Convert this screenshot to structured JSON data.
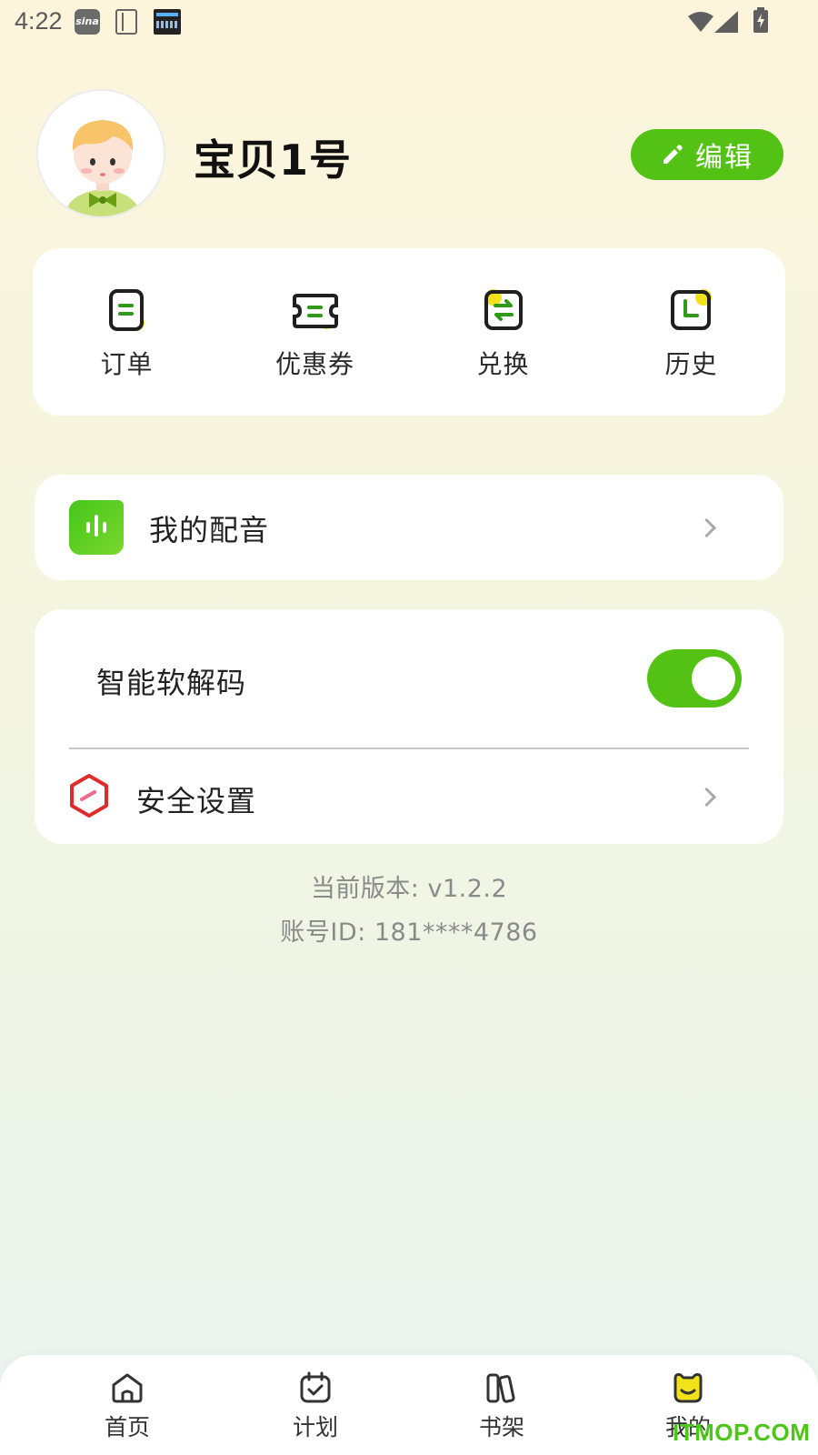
{
  "status_bar": {
    "time": "4:22",
    "icons": [
      "sina-weibo-icon",
      "notebook-icon",
      "clock-widget-icon",
      "wifi-icon",
      "signal-icon",
      "battery-charging-icon"
    ]
  },
  "profile": {
    "username": "宝贝1号",
    "edit_label": "编辑",
    "avatar_icon": "child-avatar"
  },
  "shortcuts": [
    {
      "label": "订单",
      "icon": "order-icon"
    },
    {
      "label": "优惠券",
      "icon": "coupon-icon"
    },
    {
      "label": "兑换",
      "icon": "exchange-icon"
    },
    {
      "label": "历史",
      "icon": "history-icon"
    }
  ],
  "dubbing": {
    "label": "我的配音",
    "icon": "audio-bars-icon"
  },
  "settings": {
    "decoder_label": "智能软解码",
    "decoder_enabled": true,
    "security_label": "安全设置",
    "security_icon": "hexagon-shield-icon"
  },
  "footer_info": {
    "version": "当前版本: v1.2.2",
    "account": "账号ID: 181****4786"
  },
  "bottom_nav": [
    {
      "label": "首页",
      "icon": "home-icon",
      "active": false
    },
    {
      "label": "计划",
      "icon": "calendar-check-icon",
      "active": false
    },
    {
      "label": "书架",
      "icon": "bookshelf-icon",
      "active": false
    },
    {
      "label": "我的",
      "icon": "mascot-face-icon",
      "active": true
    }
  ],
  "watermark": "ITMOP.COM",
  "colors": {
    "accent_green": "#53c214",
    "highlight_yellow": "#f2e21a",
    "security_red": "#e02b2b"
  }
}
